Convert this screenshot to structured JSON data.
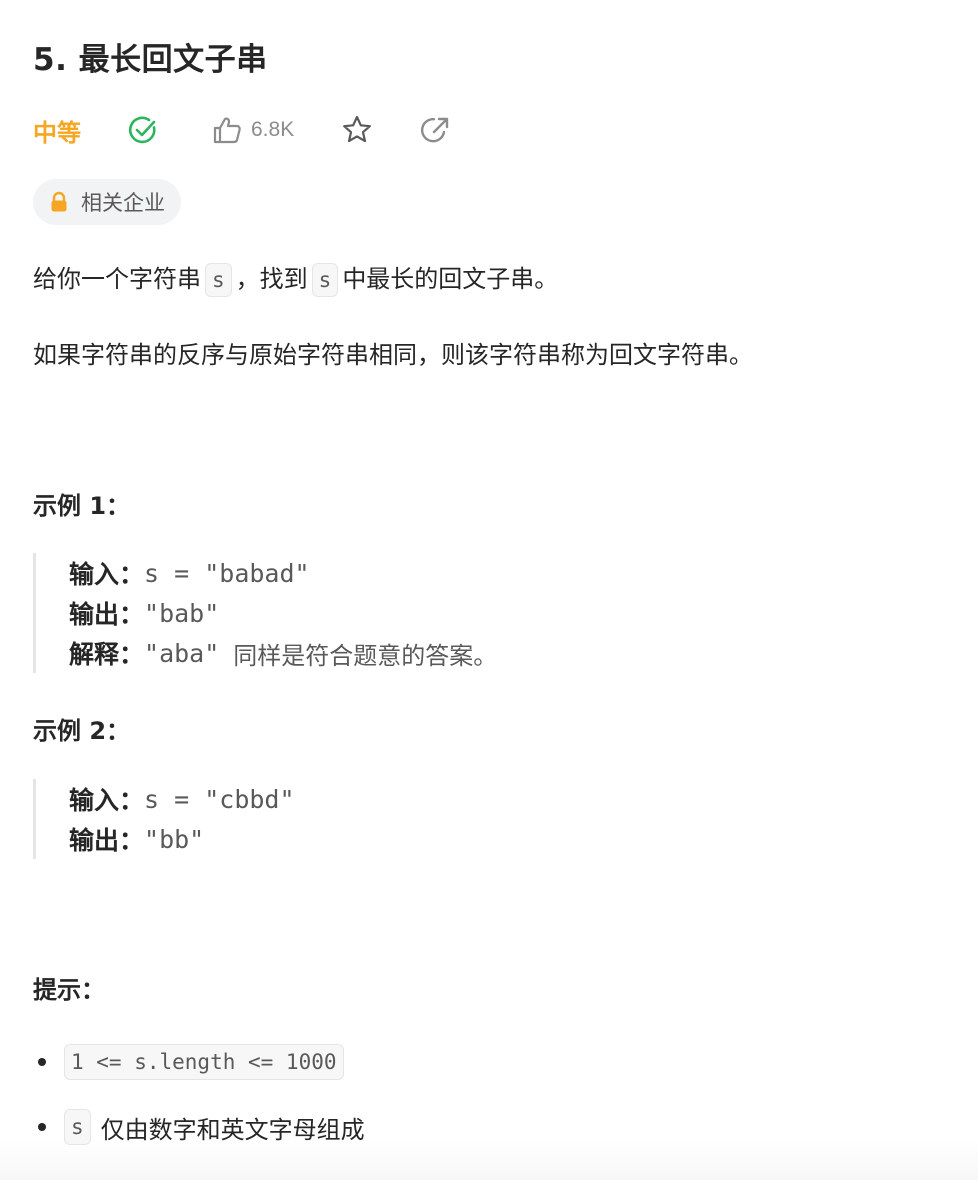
{
  "problem": {
    "title": "5. 最长回文子串",
    "difficulty": "中等",
    "likes": "6.8K",
    "company_tag": "相关企业"
  },
  "description": {
    "p1_before": "给你一个字符串",
    "p1_code1": "s",
    "p1_mid": "，找到",
    "p1_code2": "s",
    "p1_after": "中最长的回文子串。",
    "p2": "如果字符串的反序与原始字符串相同，则该字符串称为回文字符串。"
  },
  "examples": [
    {
      "title": "示例 1：",
      "input_label": "输入：",
      "input": "s = \"babad\"",
      "output_label": "输出：",
      "output": "\"bab\"",
      "explain_label": "解释：",
      "explain_code": "\"aba\"",
      "explain_text": "同样是符合题意的答案。"
    },
    {
      "title": "示例 2：",
      "input_label": "输入：",
      "input": "s = \"cbbd\"",
      "output_label": "输出：",
      "output": "\"bb\""
    }
  ],
  "hints": {
    "title": "提示：",
    "items": [
      {
        "code": "1 <= s.length <= 1000",
        "text": ""
      },
      {
        "code": "s",
        "text": "仅由数字和英文字母组成"
      }
    ]
  },
  "colors": {
    "difficulty": "#f5a623",
    "solved_check": "#2db55d",
    "lock": "#f5a623"
  },
  "icons": [
    "check-circle-icon",
    "thumbs-up-icon",
    "star-icon",
    "share-icon",
    "lock-icon"
  ]
}
